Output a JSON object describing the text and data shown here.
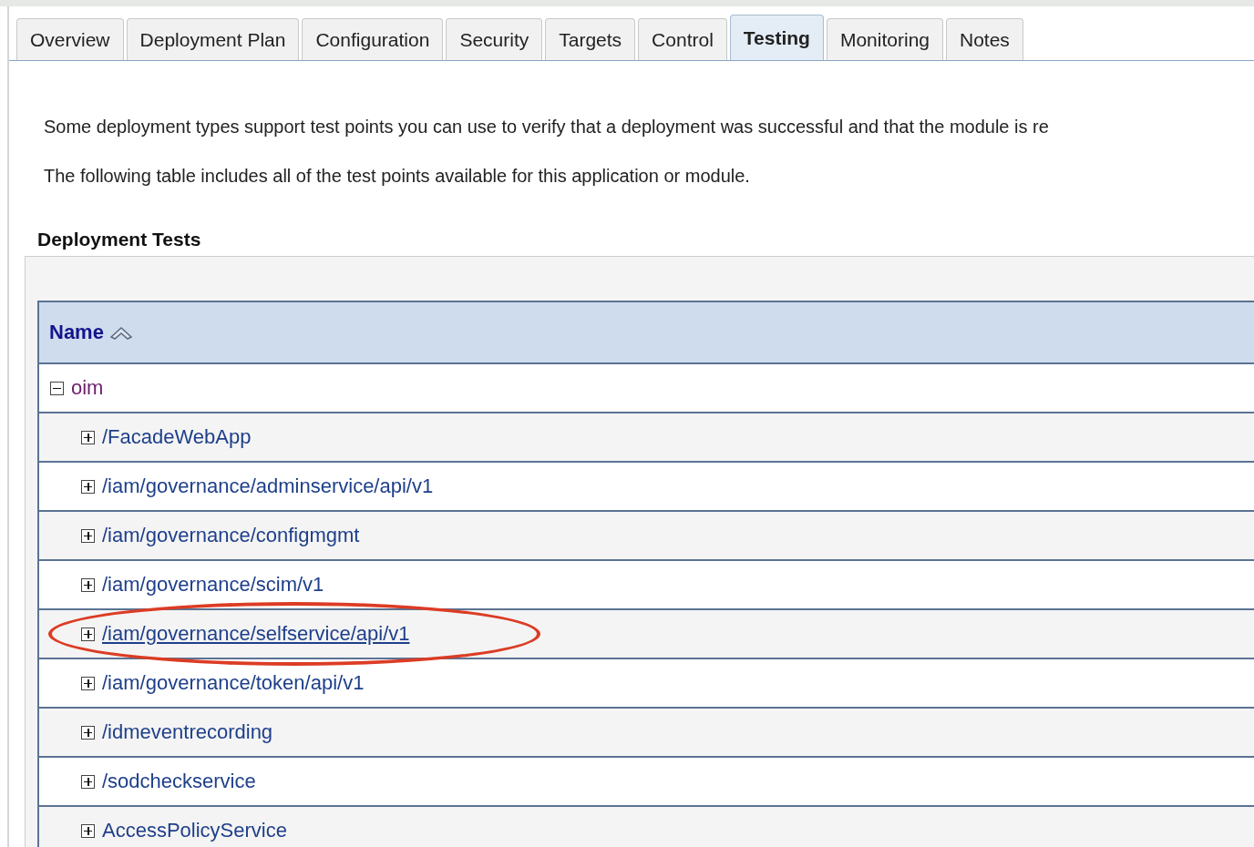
{
  "tabs": [
    {
      "label": "Overview",
      "selected": false
    },
    {
      "label": "Deployment Plan",
      "selected": false
    },
    {
      "label": "Configuration",
      "selected": false
    },
    {
      "label": "Security",
      "selected": false
    },
    {
      "label": "Targets",
      "selected": false
    },
    {
      "label": "Control",
      "selected": false
    },
    {
      "label": "Testing",
      "selected": true
    },
    {
      "label": "Monitoring",
      "selected": false
    },
    {
      "label": "Notes",
      "selected": false
    }
  ],
  "intro": [
    "Some deployment types support test points you can use to verify that a deployment was successful and that the module is re",
    "The following table includes all of the test points available for this application or module."
  ],
  "section_title": "Deployment Tests",
  "table": {
    "columns": [
      "Name"
    ],
    "tree": [
      {
        "label": "oim",
        "expanded": true,
        "highlighted": false,
        "children": [
          {
            "label": "/FacadeWebApp",
            "expanded": false,
            "highlighted": false
          },
          {
            "label": "/iam/governance/adminservice/api/v1",
            "expanded": false,
            "highlighted": false
          },
          {
            "label": "/iam/governance/configmgmt",
            "expanded": false,
            "highlighted": false
          },
          {
            "label": "/iam/governance/scim/v1",
            "expanded": false,
            "highlighted": false
          },
          {
            "label": "/iam/governance/selfservice/api/v1",
            "expanded": false,
            "highlighted": true
          },
          {
            "label": "/iam/governance/token/api/v1",
            "expanded": false,
            "highlighted": false
          },
          {
            "label": "/idmeventrecording",
            "expanded": false,
            "highlighted": false
          },
          {
            "label": "/sodcheckservice",
            "expanded": false,
            "highlighted": false
          },
          {
            "label": "AccessPolicyService",
            "expanded": false,
            "highlighted": false
          }
        ]
      }
    ]
  }
}
